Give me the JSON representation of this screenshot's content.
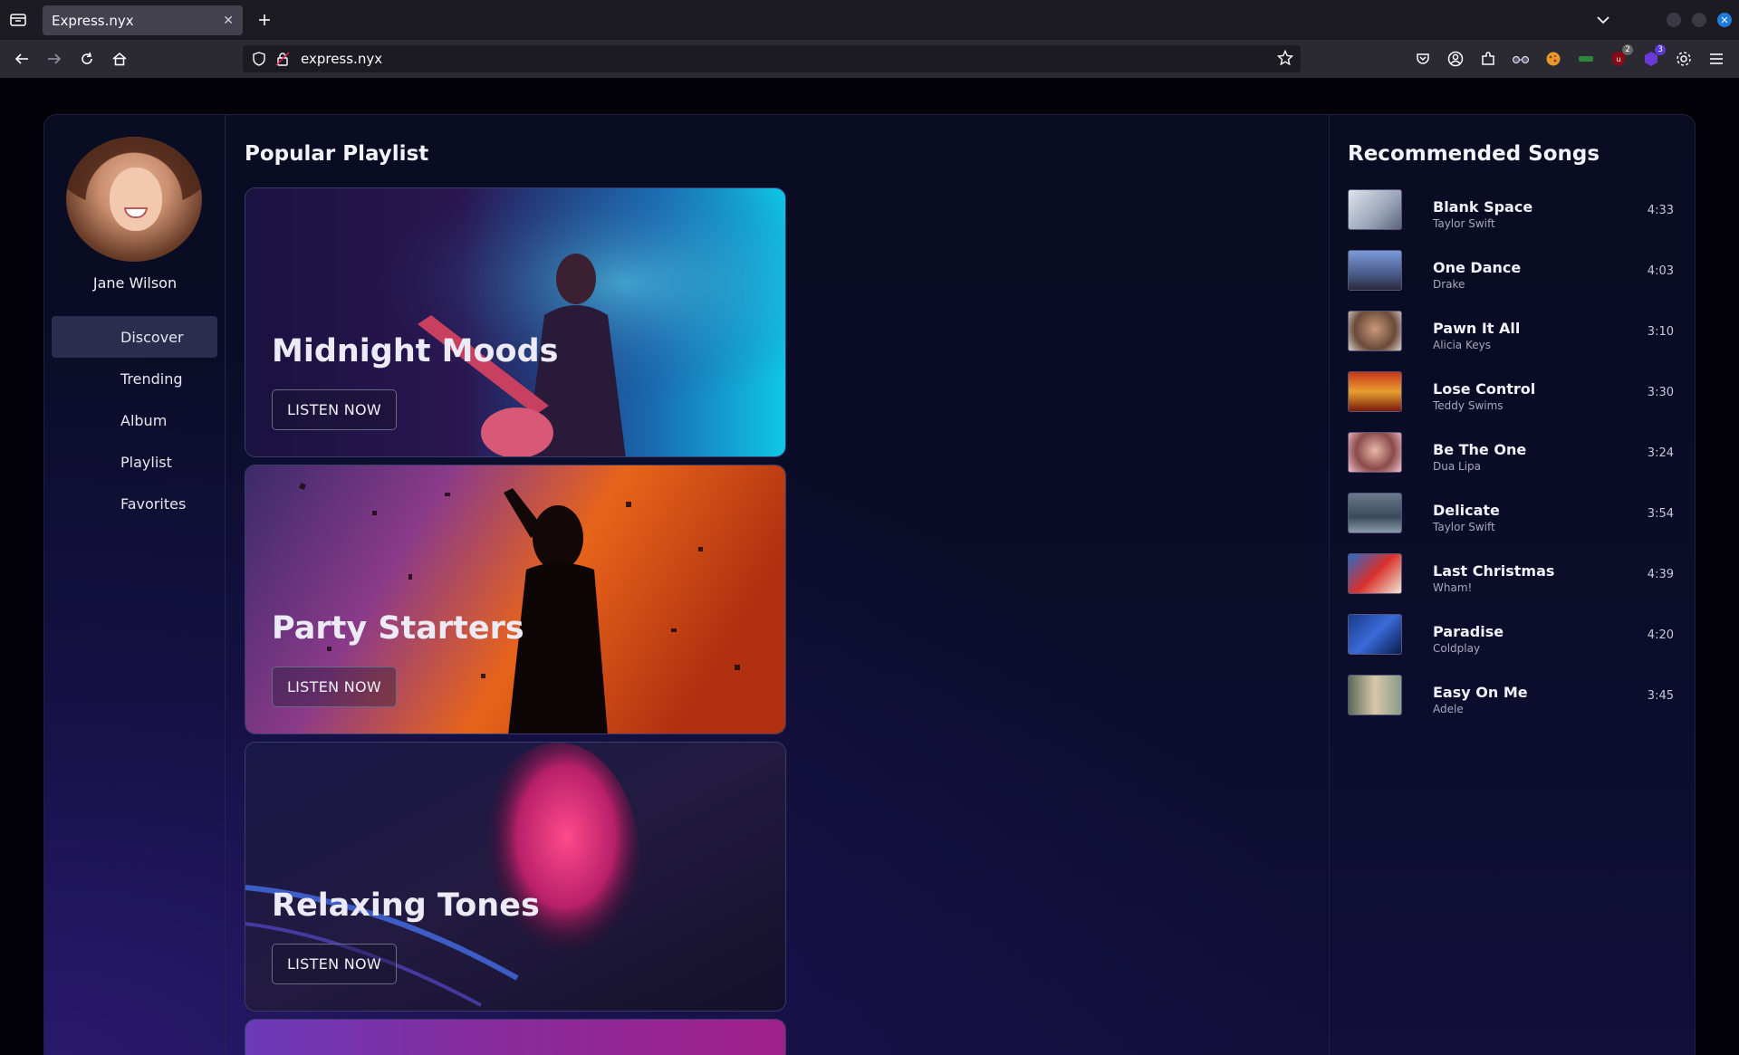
{
  "browser": {
    "tab_title": "Express.nyx",
    "url": "express.nyx",
    "ext_badges": [
      "2",
      "3"
    ]
  },
  "profile": {
    "name": "Jane Wilson"
  },
  "sidebar": {
    "items": [
      {
        "label": "Discover"
      },
      {
        "label": "Trending"
      },
      {
        "label": "Album"
      },
      {
        "label": "Playlist"
      },
      {
        "label": "Favorites"
      }
    ]
  },
  "main": {
    "title": "Popular Playlist",
    "playlists": [
      {
        "title": "Midnight Moods",
        "button": "LISTEN NOW"
      },
      {
        "title": "Party Starters",
        "button": "LISTEN NOW"
      },
      {
        "title": "Relaxing Tones",
        "button": "LISTEN NOW"
      }
    ]
  },
  "recommended": {
    "title": "Recommended Songs",
    "songs": [
      {
        "title": "Blank Space",
        "artist": "Taylor Swift",
        "duration": "4:33"
      },
      {
        "title": "One Dance",
        "artist": "Drake",
        "duration": "4:03"
      },
      {
        "title": "Pawn It All",
        "artist": "Alicia Keys",
        "duration": "3:10"
      },
      {
        "title": "Lose Control",
        "artist": "Teddy Swims",
        "duration": "3:30"
      },
      {
        "title": "Be The One",
        "artist": "Dua Lipa",
        "duration": "3:24"
      },
      {
        "title": "Delicate",
        "artist": "Taylor Swift",
        "duration": "3:54"
      },
      {
        "title": "Last Christmas",
        "artist": "Wham!",
        "duration": "4:39"
      },
      {
        "title": "Paradise",
        "artist": "Coldplay",
        "duration": "4:20"
      },
      {
        "title": "Easy On Me",
        "artist": "Adele",
        "duration": "3:45"
      }
    ]
  },
  "colors": {
    "accent": "#2b2d4f",
    "page_bg": "#0a0c22",
    "tab_bg": "#42414d"
  }
}
